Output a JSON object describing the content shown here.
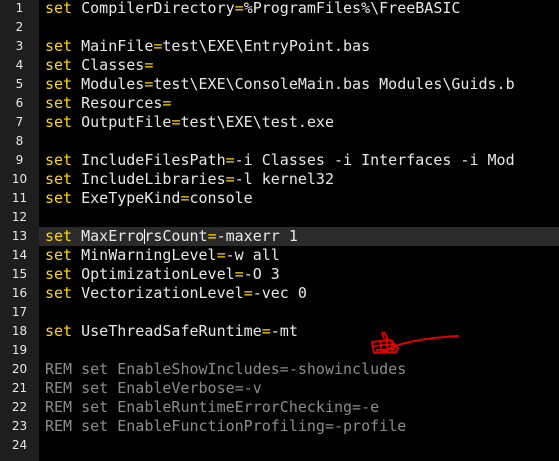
{
  "editor": {
    "lines": [
      {
        "num": "1",
        "kw": "set",
        "name": "CompilerDirectory",
        "op": "=",
        "value": "%ProgramFiles%\\FreeBASIC"
      },
      {
        "num": "2"
      },
      {
        "num": "3",
        "kw": "set",
        "name": "MainFile",
        "op": "=",
        "value": "test\\EXE\\EntryPoint.bas"
      },
      {
        "num": "4",
        "kw": "set",
        "name": "Classes",
        "op": "=",
        "value": ""
      },
      {
        "num": "5",
        "kw": "set",
        "name": "Modules",
        "op": "=",
        "value": "test\\EXE\\ConsoleMain.bas Modules\\Guids.b"
      },
      {
        "num": "6",
        "kw": "set",
        "name": "Resources",
        "op": "=",
        "value": ""
      },
      {
        "num": "7",
        "kw": "set",
        "name": "OutputFile",
        "op": "=",
        "value": "test\\EXE\\test.exe"
      },
      {
        "num": "8"
      },
      {
        "num": "9",
        "kw": "set",
        "name": "IncludeFilesPath",
        "op": "=",
        "value": "-i Classes -i Interfaces -i Mod"
      },
      {
        "num": "10",
        "kw": "set",
        "name": "IncludeLibraries",
        "op": "=",
        "value": "-l kernel32"
      },
      {
        "num": "11",
        "kw": "set",
        "name": "ExeTypeKind",
        "op": "=",
        "value": "console"
      },
      {
        "num": "12"
      },
      {
        "num": "13",
        "kw": "set",
        "name_a": "MaxErro",
        "name_b": "rsCount",
        "op": "=",
        "value": "-maxerr 1",
        "current": true
      },
      {
        "num": "14",
        "kw": "set",
        "name": "MinWarningLevel",
        "op": "=",
        "value": "-w all"
      },
      {
        "num": "15",
        "kw": "set",
        "name": "OptimizationLevel",
        "op": "=",
        "value": "-O 3"
      },
      {
        "num": "16",
        "kw": "set",
        "name": "VectorizationLevel",
        "op": "=",
        "value": "-vec 0"
      },
      {
        "num": "17"
      },
      {
        "num": "18",
        "kw": "set",
        "name": "UseThreadSafeRuntime",
        "op": "=",
        "value": "-mt"
      },
      {
        "num": "19"
      },
      {
        "num": "20",
        "rem": "REM set EnableShowIncludes=-showincludes"
      },
      {
        "num": "21",
        "rem": "REM set EnableVerbose=-v"
      },
      {
        "num": "22",
        "rem": "REM set EnableRuntimeErrorChecking=-e"
      },
      {
        "num": "23",
        "rem": "REM set EnableFunctionProfiling=-profile"
      },
      {
        "num": "24"
      }
    ]
  },
  "colors": {
    "background": "#000000",
    "gutter": "#1e1e1e",
    "keyword": "#ffd700",
    "text": "#e8e8e8",
    "comment": "#8c8c8c",
    "annotation": "#e00000"
  }
}
